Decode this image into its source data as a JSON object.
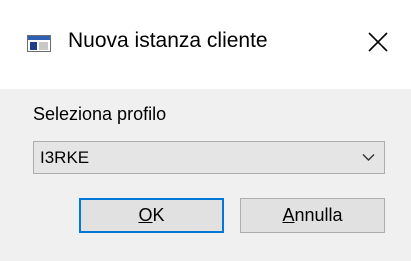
{
  "window": {
    "title": "Nuova istanza cliente",
    "app_icon": "window-icon",
    "close_icon": "close-icon"
  },
  "form": {
    "label": "Seleziona profilo",
    "profile_select": {
      "value": "I3RKE",
      "chevron_icon": "chevron-down-icon"
    }
  },
  "buttons": {
    "ok": {
      "mnemonic": "O",
      "rest": "K"
    },
    "cancel": {
      "mnemonic": "A",
      "rest": "nnulla"
    }
  },
  "colors": {
    "focus_border": "#0078d7",
    "dialog_bg": "#f0f0f0",
    "titlebar_bg": "#ffffff"
  }
}
